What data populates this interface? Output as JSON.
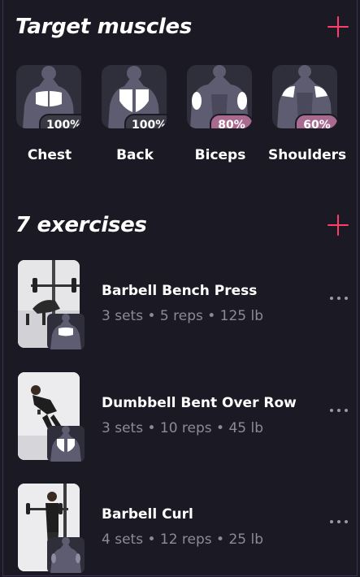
{
  "target_section": {
    "title": "Target muscles",
    "add_icon": "plus-icon"
  },
  "muscles": [
    {
      "label": "Chest",
      "percent": "100%",
      "value": 1.0
    },
    {
      "label": "Back",
      "percent": "100%",
      "value": 1.0
    },
    {
      "label": "Biceps",
      "percent": "80%",
      "value": 0.8
    },
    {
      "label": "Shoulders",
      "percent": "60%",
      "value": 0.6
    }
  ],
  "exercises_section": {
    "title": "7 exercises",
    "add_icon": "plus-icon"
  },
  "exercises": [
    {
      "name": "Barbell Bench Press",
      "meta": "3 sets • 5 reps • 125 lb"
    },
    {
      "name": "Dumbbell Bent Over Row",
      "meta": "3 sets • 10 reps • 45 lb"
    },
    {
      "name": "Barbell Curl",
      "meta": "4 sets • 12 reps • 25 lb"
    }
  ],
  "colors": {
    "background": "#1b1a24",
    "accent": "#ff3d6a",
    "card": "#2f2e3b",
    "badge_full": "#3a3a45",
    "badge_partial": "#a86b8f",
    "muted_text": "#8c8a96"
  }
}
